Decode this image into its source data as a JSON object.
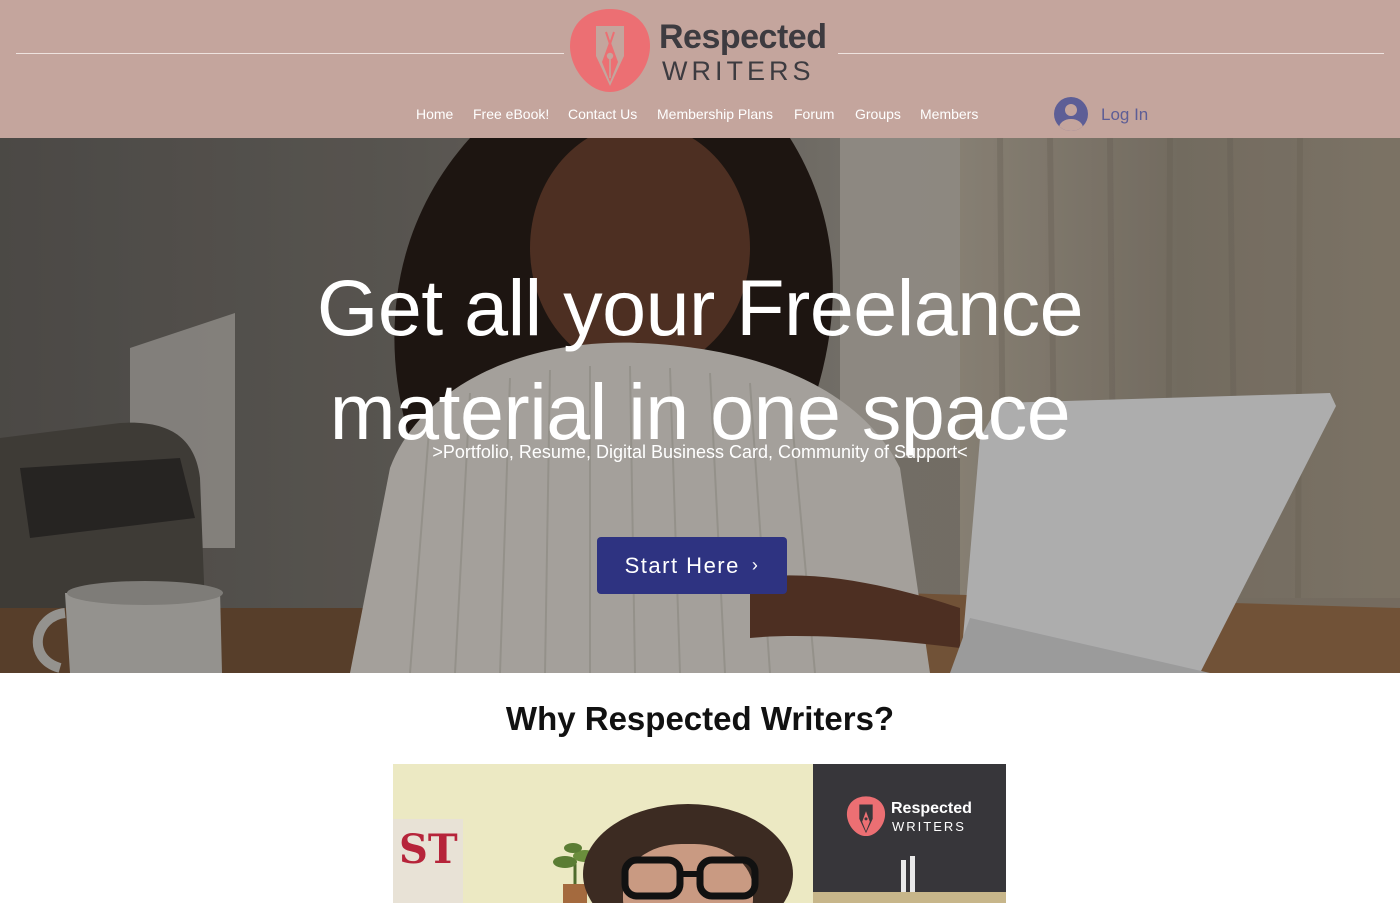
{
  "brand": {
    "name_line1": "Respected",
    "name_line2": "WRITERS",
    "accent_color": "#ec6f73",
    "header_bg": "#c4a59d"
  },
  "nav": {
    "items": [
      {
        "label": "Home"
      },
      {
        "label": "Free eBook!"
      },
      {
        "label": "Contact Us"
      },
      {
        "label": "Membership Plans"
      },
      {
        "label": "Forum"
      },
      {
        "label": "Groups"
      },
      {
        "label": "Members"
      }
    ]
  },
  "login": {
    "label": "Log In",
    "icon": "user-avatar-icon",
    "color": "#5d5e96"
  },
  "hero": {
    "title_line1": "Get all your Freelance",
    "title_line2": "material in one space",
    "subtitle": ">Portfolio, Resume, Digital Business Card, Community of Support<",
    "cta_label": "Start Here",
    "cta_icon": "chevron-right-icon",
    "cta_color": "#2e3381"
  },
  "why": {
    "title": "Why Respected Writers?",
    "video_logo_line1": "Respected",
    "video_logo_line2": "WRITERS",
    "poster_text": "ST"
  }
}
